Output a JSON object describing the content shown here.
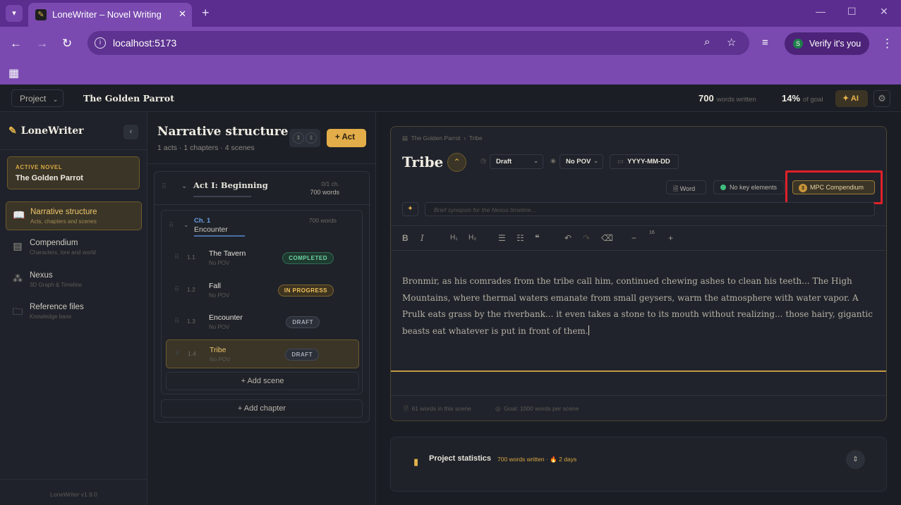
{
  "browser": {
    "tab_title": "LoneWriter – Novel Writing",
    "url": "localhost:5173",
    "profile_label": "Verify it's you",
    "profile_initial": "S"
  },
  "topbar": {
    "project_menu": "Project",
    "project_title": "The Golden Parrot",
    "words_value": "700",
    "words_label": "words written",
    "goal_value": "14%",
    "goal_label": "of goal",
    "ai_label": "AI"
  },
  "sidebar": {
    "logo": "LoneWriter",
    "active_novel_label": "ACTIVE NOVEL",
    "active_novel": "The Golden Parrot",
    "items": [
      {
        "title": "Narrative structure",
        "subtitle": "Acts, chapters and scenes",
        "icon": "book-open-icon"
      },
      {
        "title": "Compendium",
        "subtitle": "Characters, lore and world",
        "icon": "book-icon"
      },
      {
        "title": "Nexus",
        "subtitle": "3D Graph & Timeline",
        "icon": "graph-icon"
      },
      {
        "title": "Reference files",
        "subtitle": "Knowledge base",
        "icon": "folder-icon"
      }
    ],
    "version": "LoneWriter v1.9.0"
  },
  "structure": {
    "title": "Narrative structure",
    "subtitle": "1 acts · 1 chapters · 4 scenes",
    "add_act": "Act",
    "act": {
      "name": "Act I: Beginning",
      "chapters_meta": "0/1 ch.",
      "words_meta": "700 words"
    },
    "chapter": {
      "number": "Ch. 1",
      "name": "Encounter",
      "words": "700 words"
    },
    "scenes": [
      {
        "num": "1.1",
        "name": "The Tavern",
        "pov": "No POV",
        "status": "COMPLETED"
      },
      {
        "num": "1.2",
        "name": "Fall",
        "pov": "No POV",
        "status": "IN PROGRESS"
      },
      {
        "num": "1.3",
        "name": "Encounter",
        "pov": "No POV",
        "status": "DRAFT"
      },
      {
        "num": "1.4",
        "name": "Tribe",
        "pov": "No POV",
        "status": "DRAFT"
      }
    ],
    "add_scene": "Add scene",
    "add_chapter": "Add chapter"
  },
  "editor": {
    "crumb_project": "The Golden Parrot",
    "crumb_scene": "Tribe",
    "scene_title": "Tribe",
    "status_value": "Draft",
    "pov_value": "No POV",
    "date_value": "YYYY-MM-DD",
    "word_btn": "Word",
    "key_elements": "No key elements",
    "mpc_count": "3",
    "mpc_label": "MPC Compendium",
    "synopsis_placeholder": "Brief synopsis for the Nexus timeline...",
    "font_size": "16",
    "text": "Bronmir, as his comrades from the tribe call him, continued chewing ashes to clean his teeth... The High Mountains, where thermal waters emanate from small geysers, warm the atmosphere with water vapor. A Prulk eats grass by the riverbank... it even takes a stone to its mouth without realizing... those hairy, gigantic beasts eat whatever is put in front of them.",
    "words_in_scene": "61 words in this scene",
    "goal": "Goal: 1000 words per scene"
  },
  "stats": {
    "title": "Project statistics",
    "meta_words": "700 words written ·",
    "meta_days": "2 days"
  }
}
